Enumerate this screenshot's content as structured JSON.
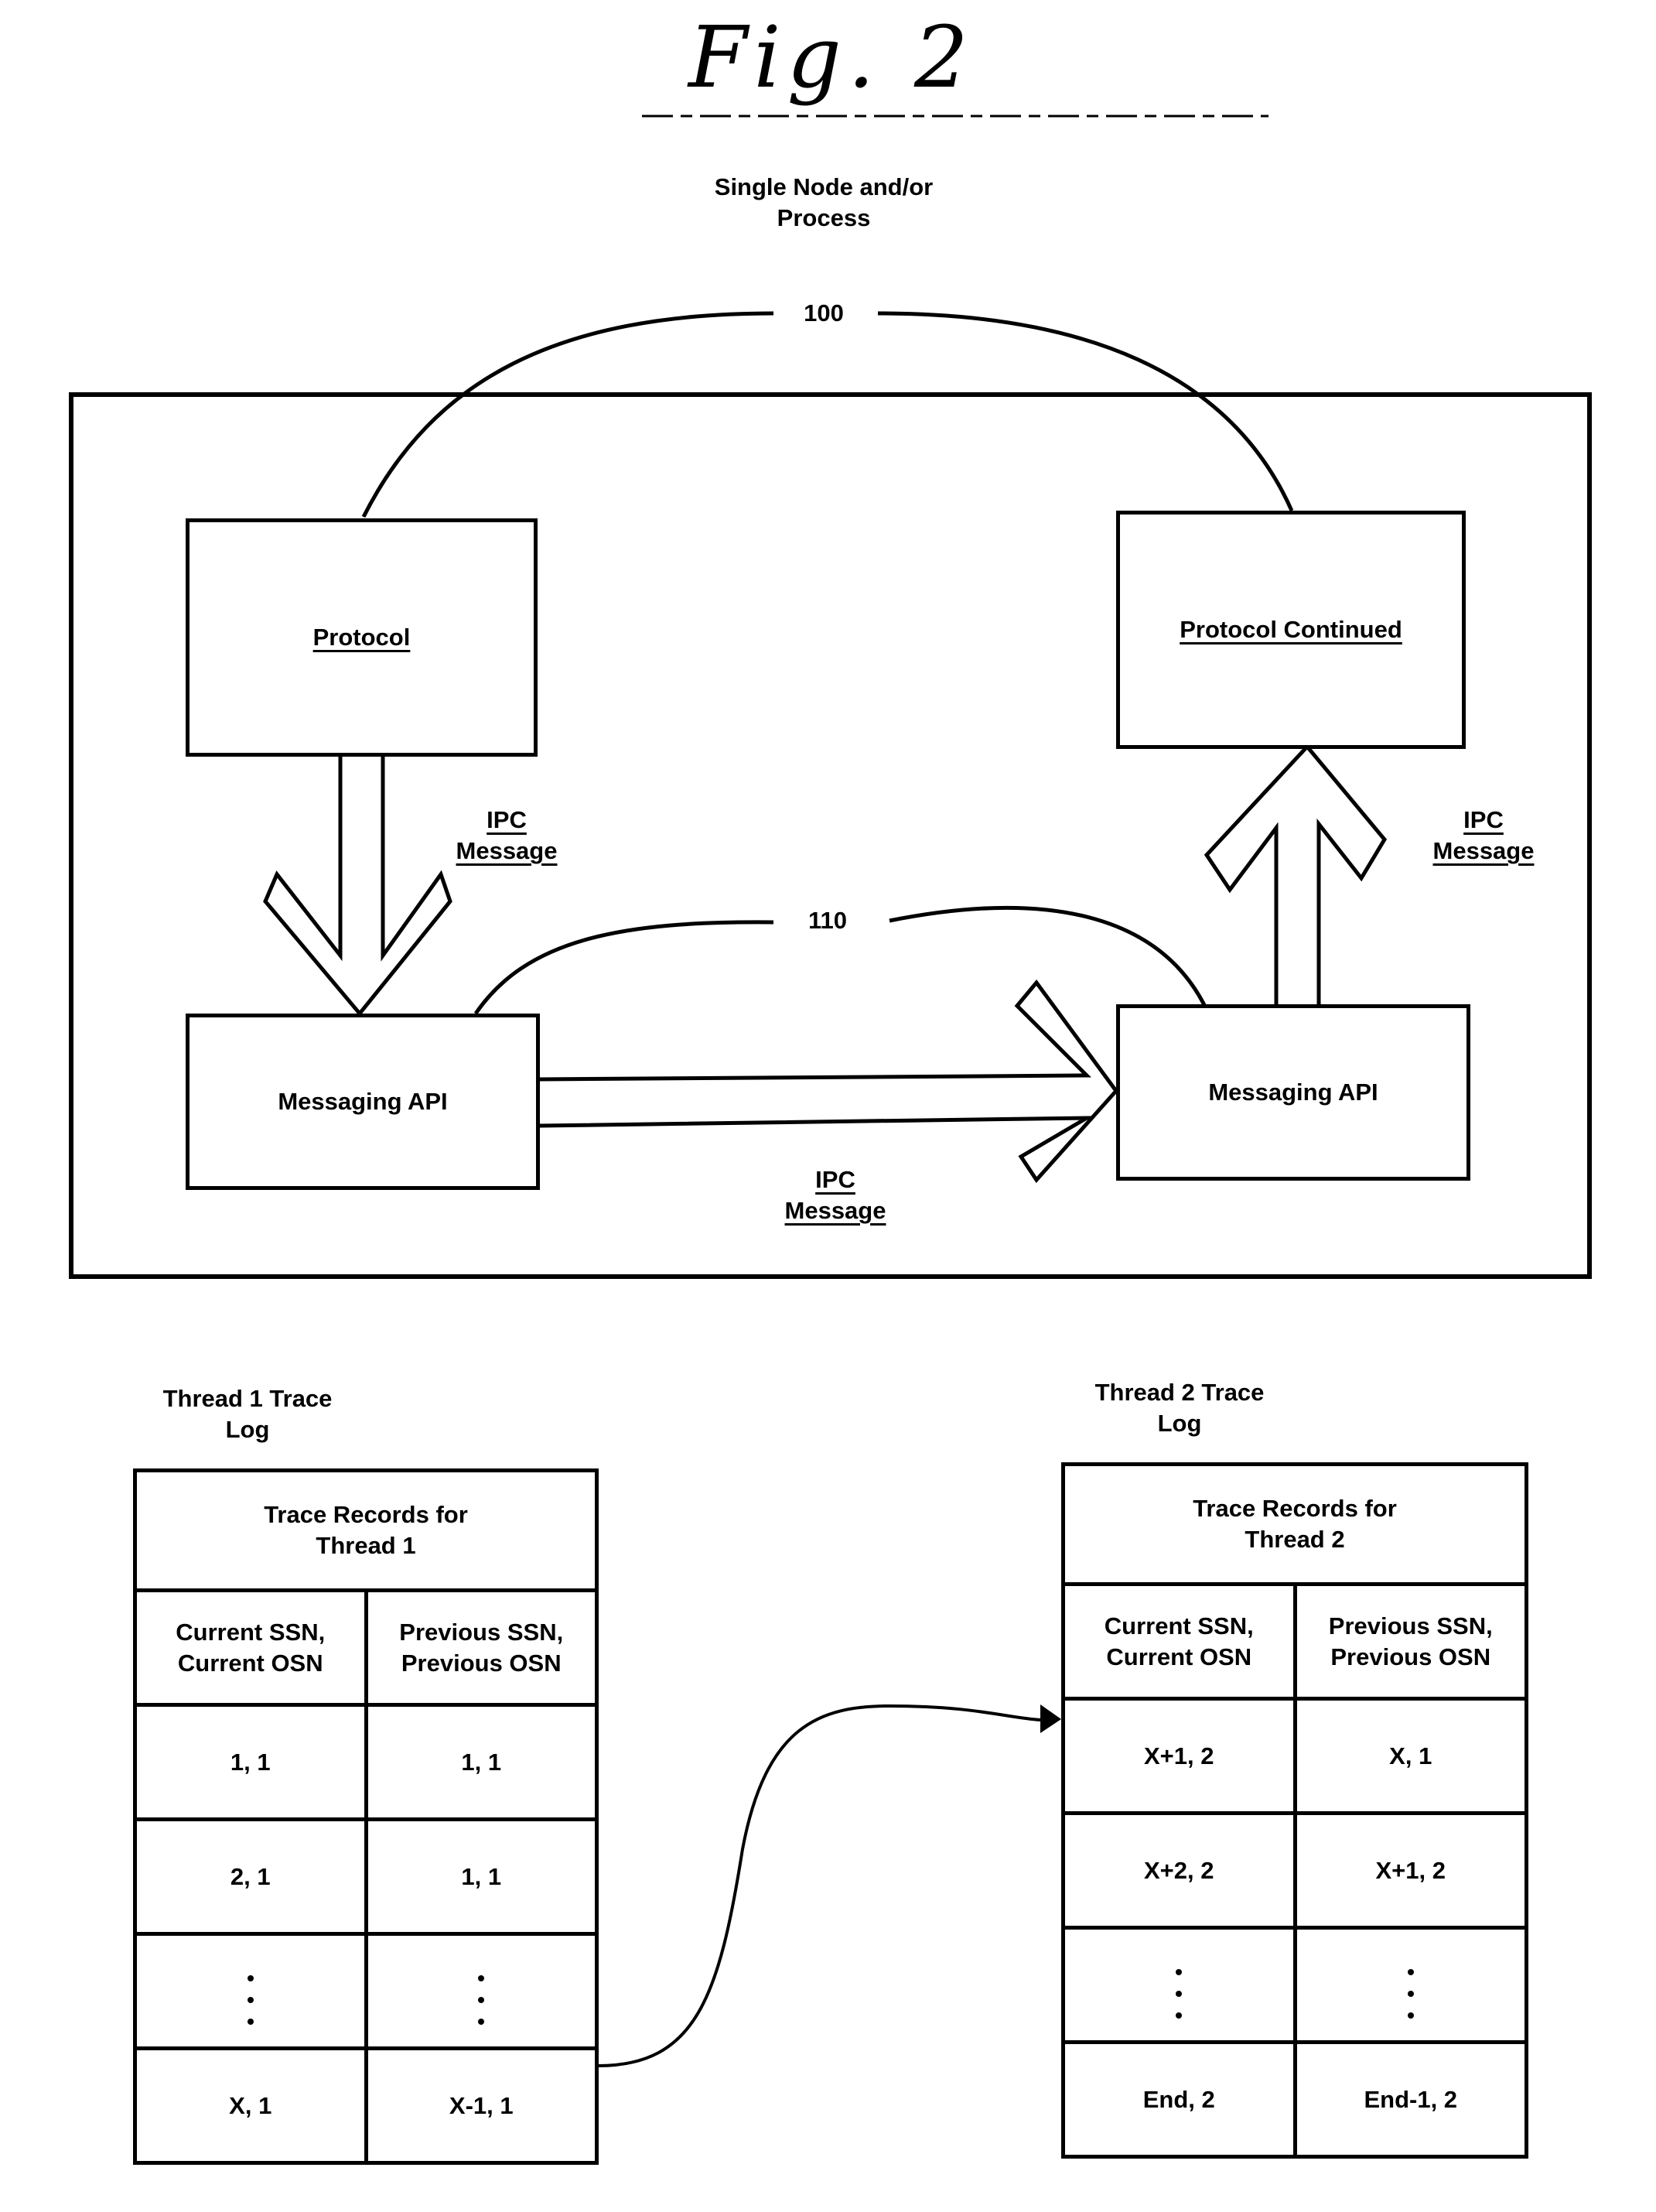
{
  "figure": {
    "title": "Fig. 2",
    "heading_line1": "Single Node and/or",
    "heading_line2": "Process"
  },
  "diagram": {
    "ref_outer": "100",
    "ref_inner": "110",
    "boxes": {
      "protocol": "Protocol",
      "protocol_continued": "Protocol Continued",
      "messaging_api_left": "Messaging API",
      "messaging_api_right": "Messaging API"
    },
    "arrows": [
      {
        "from": "Protocol",
        "to": "Messaging API (left)",
        "label_line1": "IPC",
        "label_line2": "Message"
      },
      {
        "from": "Messaging API (left)",
        "to": "Messaging API (right)",
        "label_line1": "IPC",
        "label_line2": "Message"
      },
      {
        "from": "Messaging API (right)",
        "to": "Protocol Continued",
        "label_line1": "IPC",
        "label_line2": "Message"
      }
    ]
  },
  "thread1": {
    "caption_line1": "Thread 1 Trace",
    "caption_line2": "Log",
    "table_title_line1": "Trace Records for",
    "table_title_line2": "Thread 1",
    "col1_header_line1": "Current SSN,",
    "col1_header_line2": "Current OSN",
    "col2_header_line1": "Previous SSN,",
    "col2_header_line2": "Previous OSN",
    "rows": [
      {
        "current": "1, 1",
        "previous": "1, 1"
      },
      {
        "current": "2, 1",
        "previous": "1, 1"
      },
      {
        "current": "⋮",
        "previous": "⋮"
      },
      {
        "current": "X, 1",
        "previous": "X-1, 1"
      }
    ]
  },
  "thread2": {
    "caption_line1": "Thread 2 Trace",
    "caption_line2": "Log",
    "table_title_line1": "Trace Records for",
    "table_title_line2": "Thread 2",
    "col1_header_line1": "Current SSN,",
    "col1_header_line2": "Current OSN",
    "col2_header_line1": "Previous SSN,",
    "col2_header_line2": "Previous OSN",
    "rows": [
      {
        "current": "X+1, 2",
        "previous": "X, 1"
      },
      {
        "current": "X+2, 2",
        "previous": "X+1, 2"
      },
      {
        "current": "⋮",
        "previous": "⋮"
      },
      {
        "current": "End, 2",
        "previous": "End-1, 2"
      }
    ]
  },
  "links": {
    "thread1_to_thread2": "X, 1 record links to X+1, 2 record"
  }
}
